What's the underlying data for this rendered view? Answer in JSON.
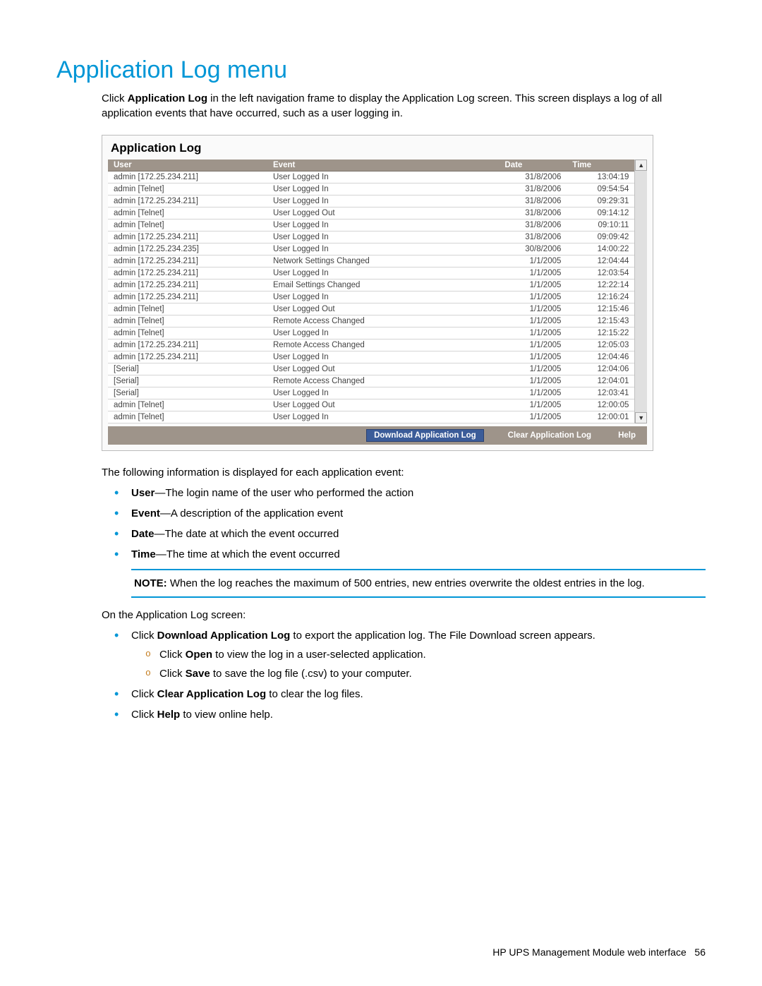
{
  "title": "Application Log menu",
  "intro_pre": "Click ",
  "intro_bold": "Application Log",
  "intro_post": " in the left navigation frame to display the Application Log screen. This screen displays a log of all application events that have occurred, such as a user logging in.",
  "panel": {
    "title": "Application Log",
    "headers": {
      "user": "User",
      "event": "Event",
      "date": "Date",
      "time": "Time"
    },
    "rows": [
      {
        "user": "admin [172.25.234.211]",
        "event": "User Logged In",
        "date": "31/8/2006",
        "time": "13:04:19"
      },
      {
        "user": "admin [Telnet]",
        "event": "User Logged In",
        "date": "31/8/2006",
        "time": "09:54:54"
      },
      {
        "user": "admin [172.25.234.211]",
        "event": "User Logged In",
        "date": "31/8/2006",
        "time": "09:29:31"
      },
      {
        "user": "admin [Telnet]",
        "event": "User Logged Out",
        "date": "31/8/2006",
        "time": "09:14:12"
      },
      {
        "user": "admin [Telnet]",
        "event": "User Logged In",
        "date": "31/8/2006",
        "time": "09:10:11"
      },
      {
        "user": "admin [172.25.234.211]",
        "event": "User Logged In",
        "date": "31/8/2006",
        "time": "09:09:42"
      },
      {
        "user": "admin [172.25.234.235]",
        "event": "User Logged In",
        "date": "30/8/2006",
        "time": "14:00:22"
      },
      {
        "user": "admin [172.25.234.211]",
        "event": "Network Settings Changed",
        "date": "1/1/2005",
        "time": "12:04:44"
      },
      {
        "user": "admin [172.25.234.211]",
        "event": "User Logged In",
        "date": "1/1/2005",
        "time": "12:03:54"
      },
      {
        "user": "admin [172.25.234.211]",
        "event": "Email Settings Changed",
        "date": "1/1/2005",
        "time": "12:22:14"
      },
      {
        "user": "admin [172.25.234.211]",
        "event": "User Logged In",
        "date": "1/1/2005",
        "time": "12:16:24"
      },
      {
        "user": "admin [Telnet]",
        "event": "User Logged Out",
        "date": "1/1/2005",
        "time": "12:15:46"
      },
      {
        "user": "admin [Telnet]",
        "event": "Remote Access Changed",
        "date": "1/1/2005",
        "time": "12:15:43"
      },
      {
        "user": "admin [Telnet]",
        "event": "User Logged In",
        "date": "1/1/2005",
        "time": "12:15:22"
      },
      {
        "user": "admin [172.25.234.211]",
        "event": "Remote Access Changed",
        "date": "1/1/2005",
        "time": "12:05:03"
      },
      {
        "user": "admin [172.25.234.211]",
        "event": "User Logged In",
        "date": "1/1/2005",
        "time": "12:04:46"
      },
      {
        "user": "[Serial]",
        "event": "User Logged Out",
        "date": "1/1/2005",
        "time": "12:04:06"
      },
      {
        "user": "[Serial]",
        "event": "Remote Access Changed",
        "date": "1/1/2005",
        "time": "12:04:01"
      },
      {
        "user": "[Serial]",
        "event": "User Logged In",
        "date": "1/1/2005",
        "time": "12:03:41"
      },
      {
        "user": "admin [Telnet]",
        "event": "User Logged Out",
        "date": "1/1/2005",
        "time": "12:00:05"
      },
      {
        "user": "admin [Telnet]",
        "event": "User Logged In",
        "date": "1/1/2005",
        "time": "12:00:01"
      }
    ],
    "buttons": {
      "download": "Download Application Log",
      "clear": "Clear Application Log",
      "help": "Help"
    }
  },
  "desc_lead": "The following information is displayed for each application event:",
  "fields": [
    {
      "name": "User",
      "desc": "—The login name of the user who performed the action"
    },
    {
      "name": "Event",
      "desc": "—A description of the application event"
    },
    {
      "name": "Date",
      "desc": "—The date at which the event occurred"
    },
    {
      "name": "Time",
      "desc": "—The time at which the event occurred"
    }
  ],
  "note_label": "NOTE:",
  "note_text": "  When the log reaches the maximum of 500 entries, new entries overwrite the oldest entries in the log.",
  "actions_lead": "On the Application Log screen:",
  "action1_pre": "Click ",
  "action1_bold": "Download Application Log",
  "action1_post": " to export the application log. The File Download screen appears.",
  "sub1_pre": "Click ",
  "sub1_bold": "Open",
  "sub1_post": " to view the log in a user-selected application.",
  "sub2_pre": "Click ",
  "sub2_bold": "Save",
  "sub2_post": " to save the log file (.csv) to your computer.",
  "action2_pre": "Click ",
  "action2_bold": "Clear Application Log",
  "action2_post": " to clear the log files.",
  "action3_pre": "Click ",
  "action3_bold": "Help",
  "action3_post": " to view online help.",
  "footer_text": "HP UPS Management Module web interface",
  "footer_page": "56"
}
